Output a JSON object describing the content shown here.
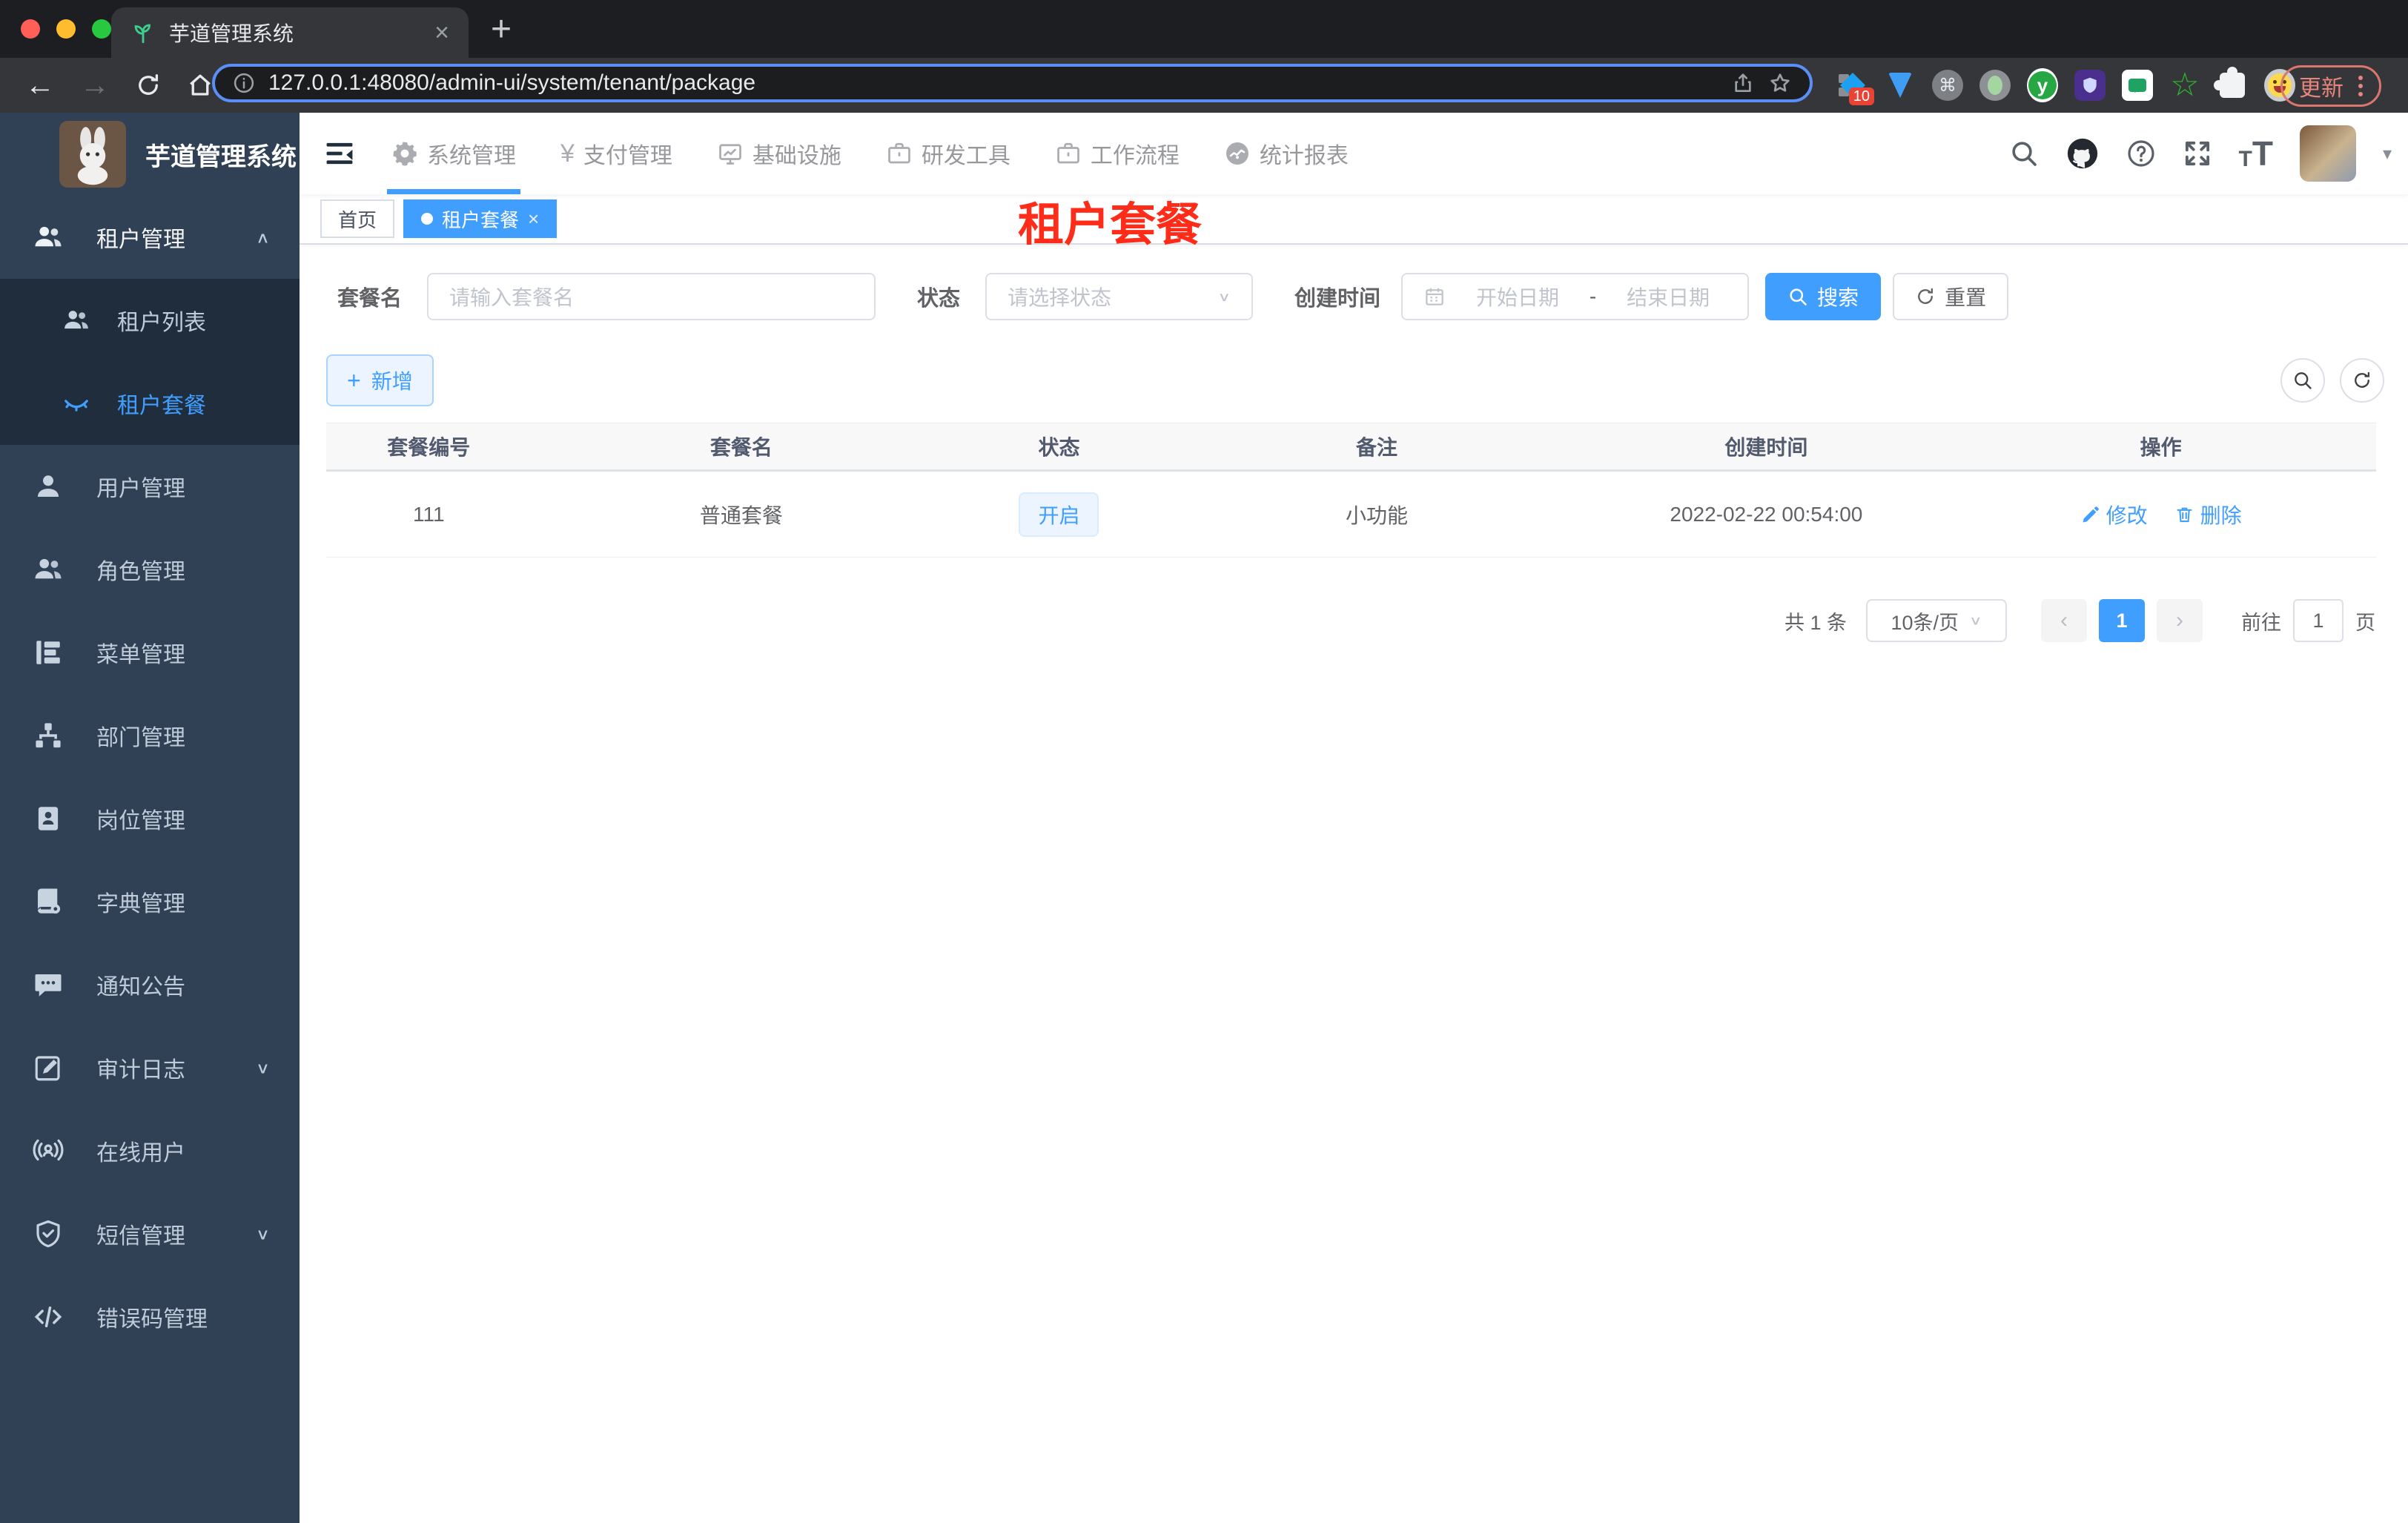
{
  "colors": {
    "primary": "#409eff",
    "sidebar_bg": "#304156",
    "submenu_bg": "#1f2d3d",
    "red_title": "#fe2c19",
    "tag_active_bg": "#409eff"
  },
  "browser": {
    "tab_title": "芋道管理系统",
    "url": "127.0.0.1:48080/admin-ui/system/tenant/package",
    "update_label": "更新",
    "ext_badge": "10",
    "ext_y_letter": "y",
    "ext_cmd_glyph": "⌘",
    "ext_star_glyph": "☆"
  },
  "icons": {
    "plus": "+",
    "close": "×",
    "back": "←",
    "forward": "→",
    "caret_up": "∧",
    "caret_down": "∨",
    "chevron_left": "‹",
    "chevron_right": "›",
    "dropdown_caret": "▾",
    "yen": "¥",
    "t_small": "T",
    "t_big": "T",
    "date_sep": "-"
  },
  "sidebar": {
    "logo_title": "芋道管理系统",
    "items": [
      {
        "label": "租户管理",
        "icon": "users-icon",
        "expanded": true,
        "parent_active": true
      },
      {
        "label": "租户列表",
        "icon": "tenant-list-icon",
        "submenu": true
      },
      {
        "label": "租户套餐",
        "icon": "tenant-package-icon",
        "submenu": true,
        "active": true
      },
      {
        "label": "用户管理",
        "icon": "user-icon"
      },
      {
        "label": "角色管理",
        "icon": "roles-icon"
      },
      {
        "label": "菜单管理",
        "icon": "menu-tree-icon"
      },
      {
        "label": "部门管理",
        "icon": "org-chart-icon"
      },
      {
        "label": "岗位管理",
        "icon": "post-badge-icon"
      },
      {
        "label": "字典管理",
        "icon": "dictionary-icon"
      },
      {
        "label": "通知公告",
        "icon": "notice-icon"
      },
      {
        "label": "审计日志",
        "icon": "audit-log-icon",
        "expandable": true
      },
      {
        "label": "在线用户",
        "icon": "online-user-icon"
      },
      {
        "label": "短信管理",
        "icon": "sms-shield-icon",
        "expandable": true
      },
      {
        "label": "错误码管理",
        "icon": "error-code-icon"
      }
    ]
  },
  "header": {
    "top_nav": [
      {
        "label": "系统管理",
        "icon": "gear-icon",
        "active": true
      },
      {
        "label": "支付管理",
        "icon": "yen-icon"
      },
      {
        "label": "基础设施",
        "icon": "monitor-icon"
      },
      {
        "label": "研发工具",
        "icon": "briefcase-icon"
      },
      {
        "label": "工作流程",
        "icon": "briefcase-icon"
      },
      {
        "label": "统计报表",
        "icon": "gauge-icon"
      }
    ]
  },
  "tags_view": {
    "home": "首页",
    "active_tag": "租户套餐"
  },
  "page_title": "租户套餐",
  "filters": {
    "name_label": "套餐名",
    "name_placeholder": "请输入套餐名",
    "status_label": "状态",
    "status_placeholder": "请选择状态",
    "date_label": "创建时间",
    "date_start_placeholder": "开始日期",
    "date_end_placeholder": "结束日期",
    "search_label": "搜索",
    "reset_label": "重置"
  },
  "toolbar": {
    "add_label": "新增"
  },
  "table": {
    "headers": [
      "套餐编号",
      "套餐名",
      "状态",
      "备注",
      "创建时间",
      "操作"
    ],
    "rows": [
      {
        "id": "111",
        "name": "普通套餐",
        "status": "开启",
        "remark": "小功能",
        "created_at": "2022-02-22 00:54:00",
        "edit_label": "修改",
        "delete_label": "删除"
      }
    ]
  },
  "pagination": {
    "total_text": "共 1 条",
    "page_size": "10条/页",
    "current_page": "1",
    "goto_label": "前往",
    "goto_value": "1",
    "page_unit": "页"
  }
}
